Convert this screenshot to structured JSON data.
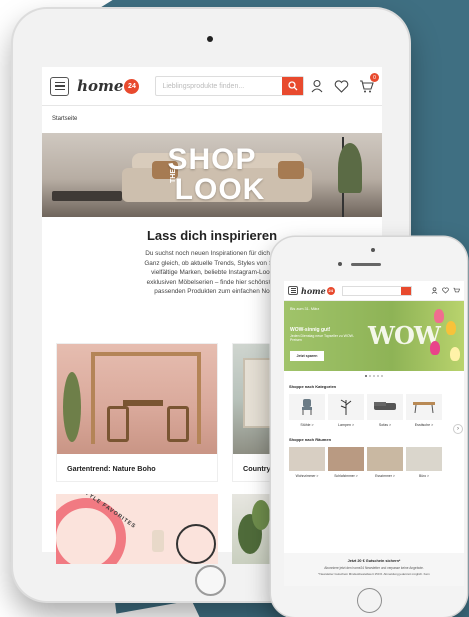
{
  "tablet": {
    "search_placeholder": "Lieblingsprodukte finden...",
    "breadcrumb": "Startseite",
    "hero": {
      "line1": "SHOP",
      "small": "THE",
      "line2": "LOOK"
    },
    "inspiration": {
      "title": "Lass dich inspirieren",
      "line1": "Du suchst noch neuen Inspirationen für dich un",
      "line2": "Ganz gleich, ob aktuelle Trends, Styles von Sko",
      "line3": "vielfältige Marken, beliebte Instagram-Look",
      "line4": "exklusiven Möbelserien – finde hier schönste I",
      "line5": "passenden Produkten zum einfachen No"
    },
    "cards": [
      {
        "caption": "Gartentrend: Nature Boho"
      },
      {
        "caption": "Country Di"
      }
    ],
    "favorites_text": "STYLE FAVORITES",
    "logo": {
      "text": "home",
      "badge": "24"
    },
    "cart_count": "0"
  },
  "phone": {
    "logo": {
      "text": "home",
      "badge": "24"
    },
    "banner": {
      "date": "Bis zum 31. März",
      "headline": "WOW-sinnig gut!",
      "sub": "Jeden Dienstag neue Topseller zu WOW-Preisen",
      "cta": "Jetzt sparen",
      "wow": "WOW"
    },
    "section_categories": "Shoppe nach Kategorien",
    "categories": [
      {
        "label": "Stühle >"
      },
      {
        "label": "Lampen >"
      },
      {
        "label": "Sofas >"
      },
      {
        "label": "Esstische >"
      }
    ],
    "section_rooms": "Shoppe nach Räumen",
    "rooms": [
      {
        "label": "Wohnzimmer >"
      },
      {
        "label": "Schlafzimmer >"
      },
      {
        "label": "Esszimmer >"
      },
      {
        "label": "Büro >"
      }
    ],
    "footer": {
      "title": "Jetzt 20 € Gutschein sichern*",
      "line1": "Abonniere jetzt den home24 Newsletter und verpasse keine Angebote.",
      "line2": "*Newsletter Gutschein Mindestbestellwert 150 €. Abmeldung jederzeit möglich. Kein"
    },
    "cart_count": "0"
  },
  "colors": {
    "brand": "#e84a2e",
    "background_shape": "#3f6f82"
  }
}
